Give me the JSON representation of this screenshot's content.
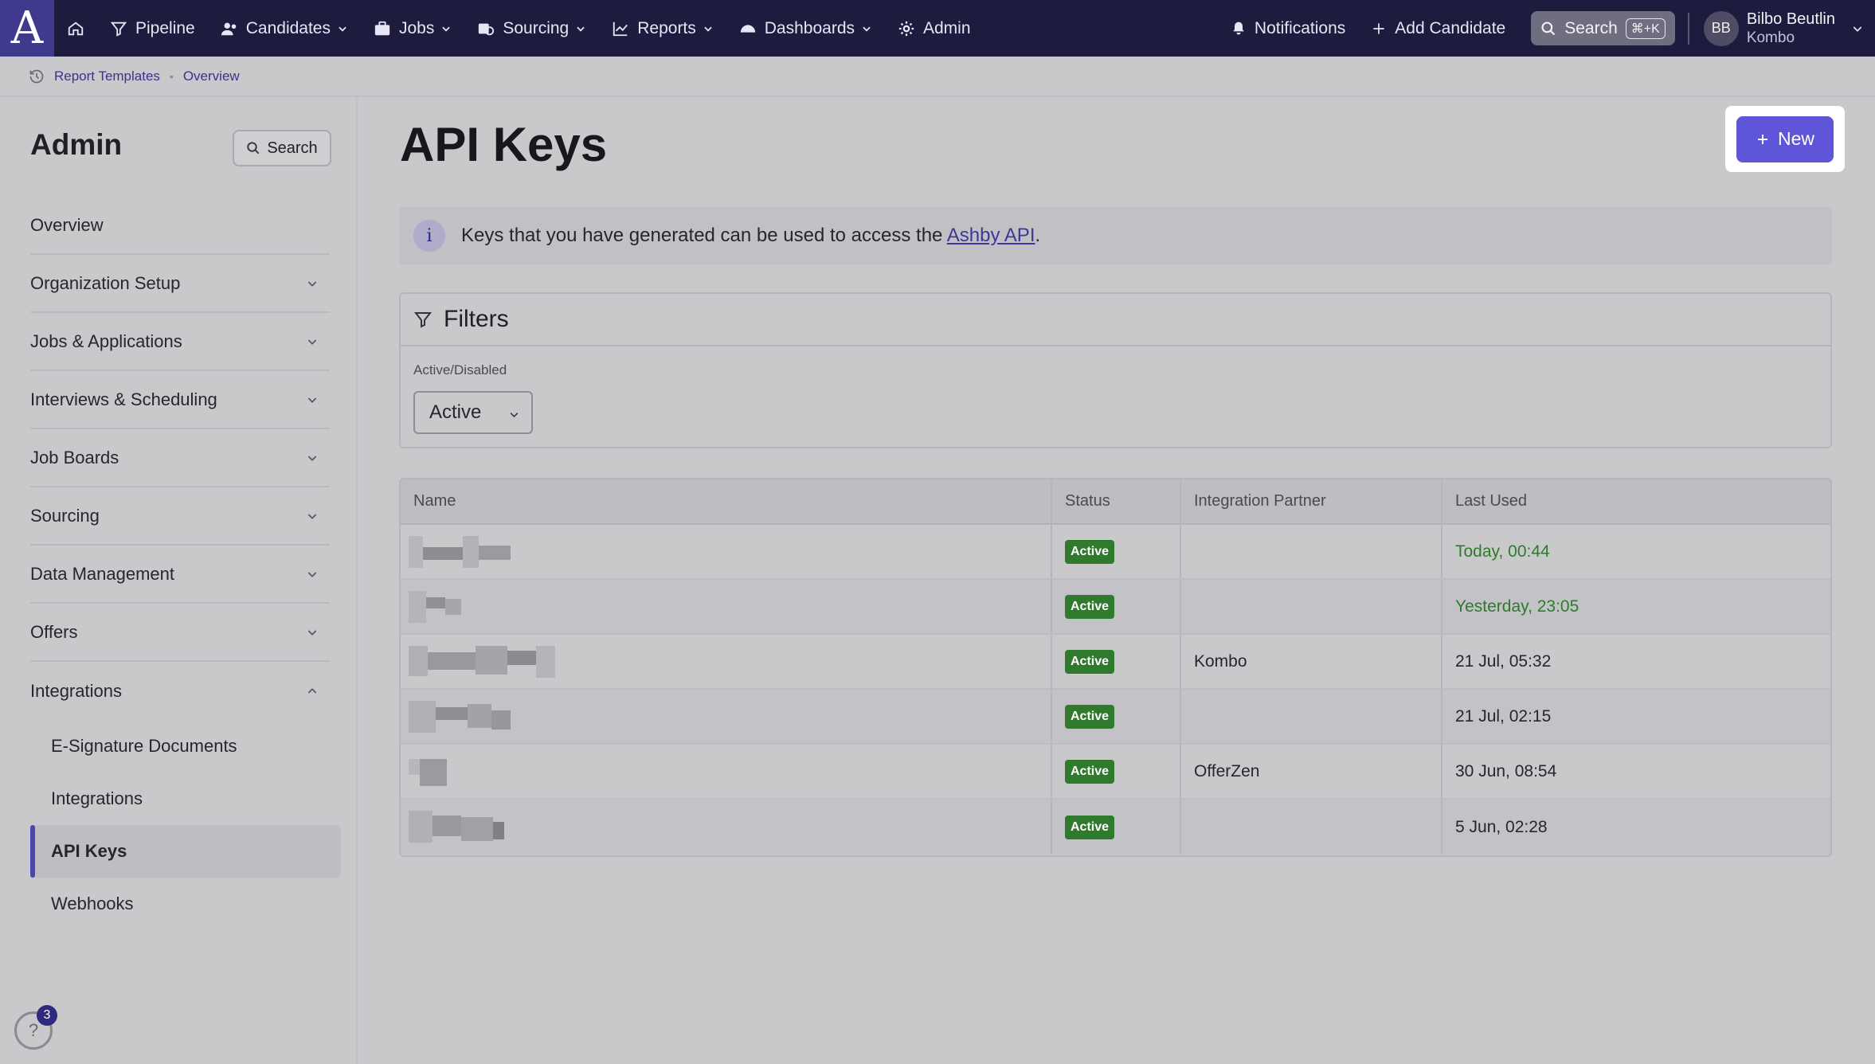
{
  "nav": {
    "logo": "A",
    "items": [
      {
        "label": "Pipeline"
      },
      {
        "label": "Candidates"
      },
      {
        "label": "Jobs"
      },
      {
        "label": "Sourcing"
      },
      {
        "label": "Reports"
      },
      {
        "label": "Dashboards"
      },
      {
        "label": "Admin"
      }
    ],
    "notifications": "Notifications",
    "add_candidate": "Add Candidate",
    "search": "Search",
    "search_shortcut": "⌘+K",
    "user": {
      "initials": "BB",
      "name": "Bilbo Beutlin",
      "org": "Kombo"
    }
  },
  "breadcrumb": {
    "items": [
      "Report Templates",
      "Overview"
    ],
    "separator": "•"
  },
  "sidebar": {
    "title": "Admin",
    "search": "Search",
    "sections": [
      {
        "label": "Overview"
      },
      {
        "label": "Organization Setup"
      },
      {
        "label": "Jobs & Applications"
      },
      {
        "label": "Interviews & Scheduling"
      },
      {
        "label": "Job Boards"
      },
      {
        "label": "Sourcing"
      },
      {
        "label": "Data Management"
      },
      {
        "label": "Offers"
      },
      {
        "label": "Integrations"
      }
    ],
    "subitems": [
      {
        "label": "E-Signature Documents"
      },
      {
        "label": "Integrations"
      },
      {
        "label": "API Keys"
      },
      {
        "label": "Webhooks"
      }
    ],
    "help_badge": "3",
    "help_icon": "?"
  },
  "main": {
    "title": "API Keys",
    "new_button": "New",
    "info": {
      "icon": "i",
      "text_before": "Keys that you have generated can be used to access the ",
      "link": "Ashby API",
      "text_after": "."
    },
    "filters": {
      "title": "Filters",
      "label": "Active/Disabled",
      "value": "Active"
    },
    "table": {
      "columns": [
        "Name",
        "Status",
        "Integration Partner",
        "Last Used"
      ],
      "rows": [
        {
          "status": "Active",
          "partner": "",
          "last_used": "Today, 00:44"
        },
        {
          "status": "Active",
          "partner": "",
          "last_used": "Yesterday, 23:05"
        },
        {
          "status": "Active",
          "partner": "Kombo",
          "last_used": "21 Jul, 05:32"
        },
        {
          "status": "Active",
          "partner": "",
          "last_used": "21 Jul, 02:15"
        },
        {
          "status": "Active",
          "partner": "OfferZen",
          "last_used": "30 Jun, 08:54"
        },
        {
          "status": "Active",
          "partner": "",
          "last_used": "5 Jun, 02:28"
        }
      ]
    }
  },
  "colors": {
    "nav_bg": "#1e1c3e",
    "accent": "#5e55d8",
    "status_green": "#2f7a2c"
  }
}
